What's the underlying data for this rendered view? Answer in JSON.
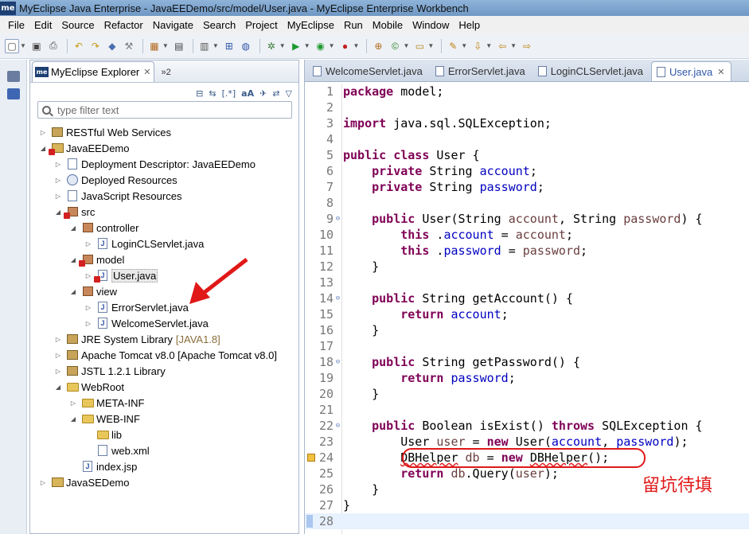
{
  "window": {
    "title": "MyEclipse Java Enterprise - JavaEEDemo/src/model/User.java - MyEclipse Enterprise Workbench",
    "logo_text": "me"
  },
  "menu": [
    "File",
    "Edit",
    "Source",
    "Refactor",
    "Navigate",
    "Search",
    "Project",
    "MyEclipse",
    "Run",
    "Mobile",
    "Window",
    "Help"
  ],
  "explorer": {
    "tab_label": "MyEclipse Explorer",
    "overflow_label": "»2",
    "filter_placeholder": "type filter text",
    "tree": [
      {
        "label": "RESTful Web Services",
        "suffix": "",
        "depth": 0,
        "twisty": "▷",
        "icon": "rest-icon"
      },
      {
        "label": "JavaEEDemo",
        "suffix": "",
        "depth": 0,
        "twisty": "◢",
        "icon": "project-icon",
        "error": true
      },
      {
        "label": "Deployment Descriptor: JavaEEDemo",
        "suffix": "",
        "depth": 1,
        "twisty": "▷",
        "icon": "descriptor-icon"
      },
      {
        "label": "Deployed Resources",
        "suffix": "",
        "depth": 1,
        "twisty": "▷",
        "icon": "web-resources-icon"
      },
      {
        "label": "JavaScript Resources",
        "suffix": "",
        "depth": 1,
        "twisty": "▷",
        "icon": "js-resources-icon"
      },
      {
        "label": "src",
        "suffix": "",
        "depth": 1,
        "twisty": "◢",
        "icon": "source-folder-icon",
        "error": true
      },
      {
        "label": "controller",
        "suffix": "",
        "depth": 2,
        "twisty": "◢",
        "icon": "package-icon"
      },
      {
        "label": "LoginCLServlet.java",
        "suffix": "",
        "depth": 3,
        "twisty": "▷",
        "icon": "java-file-icon"
      },
      {
        "label": "model",
        "suffix": "",
        "depth": 2,
        "twisty": "◢",
        "icon": "package-icon",
        "error": true
      },
      {
        "label": "User.java",
        "suffix": "",
        "depth": 3,
        "twisty": "▷",
        "icon": "java-file-icon",
        "error": true,
        "selected": true
      },
      {
        "label": "view",
        "suffix": "",
        "depth": 2,
        "twisty": "◢",
        "icon": "package-icon"
      },
      {
        "label": "ErrorServlet.java",
        "suffix": "",
        "depth": 3,
        "twisty": "▷",
        "icon": "java-file-icon"
      },
      {
        "label": "WelcomeServlet.java",
        "suffix": "",
        "depth": 3,
        "twisty": "▷",
        "icon": "java-file-icon"
      },
      {
        "label": "JRE System Library",
        "suffix": "[JAVA1.8]",
        "depth": 1,
        "twisty": "▷",
        "icon": "library-icon"
      },
      {
        "label": "Apache Tomcat v8.0 [Apache Tomcat v8.0]",
        "suffix": "",
        "depth": 1,
        "twisty": "▷",
        "icon": "library-icon"
      },
      {
        "label": "JSTL 1.2.1 Library",
        "suffix": "",
        "depth": 1,
        "twisty": "▷",
        "icon": "library-icon"
      },
      {
        "label": "WebRoot",
        "suffix": "",
        "depth": 1,
        "twisty": "◢",
        "icon": "folder-icon"
      },
      {
        "label": "META-INF",
        "suffix": "",
        "depth": 2,
        "twisty": "▷",
        "icon": "folder-icon"
      },
      {
        "label": "WEB-INF",
        "suffix": "",
        "depth": 2,
        "twisty": "◢",
        "icon": "folder-icon"
      },
      {
        "label": "lib",
        "suffix": "",
        "depth": 3,
        "twisty": "",
        "icon": "folder-icon"
      },
      {
        "label": "web.xml",
        "suffix": "",
        "depth": 3,
        "twisty": "",
        "icon": "xml-file-icon"
      },
      {
        "label": "index.jsp",
        "suffix": "",
        "depth": 2,
        "twisty": "",
        "icon": "jsp-file-icon"
      },
      {
        "label": "JavaSEDemo",
        "suffix": "",
        "depth": 0,
        "twisty": "▷",
        "icon": "project-icon"
      }
    ]
  },
  "editor": {
    "tabs": [
      {
        "label": "WelcomeServlet.java",
        "active": false
      },
      {
        "label": "ErrorServlet.java",
        "active": false
      },
      {
        "label": "LoginCLServlet.java",
        "active": false
      },
      {
        "label": "User.java",
        "active": true
      }
    ],
    "lines": [
      {
        "n": "1",
        "fold": "",
        "tokens": [
          [
            "kw",
            "package"
          ],
          [
            "",
            "model;"
          ]
        ]
      },
      {
        "n": "2",
        "fold": "",
        "tokens": []
      },
      {
        "n": "3",
        "fold": "",
        "tokens": [
          [
            "kw",
            "import"
          ],
          [
            "",
            "java.sql.SQLException;"
          ]
        ]
      },
      {
        "n": "4",
        "fold": "",
        "tokens": []
      },
      {
        "n": "5",
        "fold": "",
        "tokens": [
          [
            "kw",
            "public class"
          ],
          [
            "",
            "User {"
          ]
        ]
      },
      {
        "n": "6",
        "fold": "",
        "tokens": [
          [
            "",
            "    "
          ],
          [
            "kw",
            "private"
          ],
          [
            "",
            "String "
          ],
          [
            "fld",
            "account"
          ],
          [
            "",
            ";"
          ]
        ]
      },
      {
        "n": "7",
        "fold": "",
        "tokens": [
          [
            "",
            "    "
          ],
          [
            "kw",
            "private"
          ],
          [
            "",
            "String "
          ],
          [
            "fld",
            "password"
          ],
          [
            "",
            ";"
          ]
        ]
      },
      {
        "n": "8",
        "fold": "",
        "tokens": []
      },
      {
        "n": "9",
        "fold": "⊖",
        "tokens": [
          [
            "",
            "    "
          ],
          [
            "kw",
            "public"
          ],
          [
            "",
            "User(String "
          ],
          [
            "loc",
            "account"
          ],
          [
            "",
            ", String "
          ],
          [
            "loc",
            "password"
          ],
          [
            "",
            ") {"
          ]
        ]
      },
      {
        "n": "10",
        "fold": "",
        "tokens": [
          [
            "",
            "        "
          ],
          [
            "kw",
            "this"
          ],
          [
            "",
            "."
          ],
          [
            "fld",
            "account"
          ],
          [
            "",
            " = "
          ],
          [
            "loc",
            "account"
          ],
          [
            "",
            ";"
          ]
        ]
      },
      {
        "n": "11",
        "fold": "",
        "tokens": [
          [
            "",
            "        "
          ],
          [
            "kw",
            "this"
          ],
          [
            "",
            "."
          ],
          [
            "fld",
            "password"
          ],
          [
            "",
            " = "
          ],
          [
            "loc",
            "password"
          ],
          [
            "",
            ";"
          ]
        ]
      },
      {
        "n": "12",
        "fold": "",
        "tokens": [
          [
            "",
            "    }"
          ]
        ]
      },
      {
        "n": "13",
        "fold": "",
        "tokens": []
      },
      {
        "n": "14",
        "fold": "⊖",
        "tokens": [
          [
            "",
            "    "
          ],
          [
            "kw",
            "public"
          ],
          [
            "",
            "String getAccount() {"
          ]
        ]
      },
      {
        "n": "15",
        "fold": "",
        "tokens": [
          [
            "",
            "        "
          ],
          [
            "kw",
            "return"
          ],
          [
            "fld",
            "account"
          ],
          [
            "",
            ";"
          ]
        ]
      },
      {
        "n": "16",
        "fold": "",
        "tokens": [
          [
            "",
            "    }"
          ]
        ]
      },
      {
        "n": "17",
        "fold": "",
        "tokens": []
      },
      {
        "n": "18",
        "fold": "⊖",
        "tokens": [
          [
            "",
            "    "
          ],
          [
            "kw",
            "public"
          ],
          [
            "",
            "String getPassword() {"
          ]
        ]
      },
      {
        "n": "19",
        "fold": "",
        "tokens": [
          [
            "",
            "        "
          ],
          [
            "kw",
            "return"
          ],
          [
            "fld",
            "password"
          ],
          [
            "",
            ";"
          ]
        ]
      },
      {
        "n": "20",
        "fold": "",
        "tokens": [
          [
            "",
            "    }"
          ]
        ]
      },
      {
        "n": "21",
        "fold": "",
        "tokens": []
      },
      {
        "n": "22",
        "fold": "⊖",
        "tokens": [
          [
            "",
            "    "
          ],
          [
            "kw",
            "public"
          ],
          [
            "",
            "Boolean isExist() "
          ],
          [
            "kw",
            "throws"
          ],
          [
            "",
            "SQLException {"
          ]
        ]
      },
      {
        "n": "23",
        "fold": "",
        "tokens": [
          [
            "",
            "        User "
          ],
          [
            "loc",
            "user"
          ],
          [
            "",
            " = "
          ],
          [
            "kw",
            "new"
          ],
          [
            "",
            "User("
          ],
          [
            "fld",
            "account"
          ],
          [
            "",
            ", "
          ],
          [
            "fld",
            "password"
          ],
          [
            "",
            ");"
          ]
        ]
      },
      {
        "n": "24",
        "fold": "",
        "tokens": [
          [
            "",
            "        "
          ],
          [
            "sq",
            "DBHelper"
          ],
          [
            "",
            " "
          ],
          [
            "loc",
            "db"
          ],
          [
            "",
            " = "
          ],
          [
            "kw",
            "new"
          ],
          [
            "sq",
            "DBHelper"
          ],
          [
            "",
            "();"
          ]
        ]
      },
      {
        "n": "25",
        "fold": "",
        "tokens": [
          [
            "",
            "        "
          ],
          [
            "kw",
            "return"
          ],
          [
            "loc",
            "db"
          ],
          [
            "",
            ".Query("
          ],
          [
            "loc",
            "user"
          ],
          [
            "",
            ");"
          ]
        ]
      },
      {
        "n": "26",
        "fold": "",
        "tokens": [
          [
            "",
            "    }"
          ]
        ]
      },
      {
        "n": "27",
        "fold": "",
        "tokens": [
          [
            "",
            "}"
          ]
        ]
      },
      {
        "n": "28",
        "fold": "",
        "tokens": []
      }
    ]
  },
  "annotation": {
    "note_text": "留坑待填",
    "color": "#e01818"
  }
}
